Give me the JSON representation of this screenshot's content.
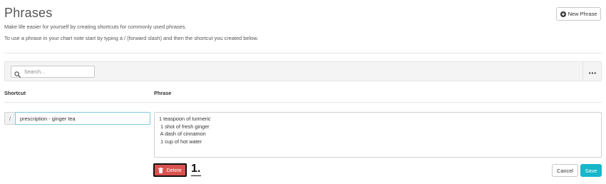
{
  "header": {
    "title": "Phrases",
    "intro_line_1": "Make life easier for yourself by creating shortcuts for commonly used phrases.",
    "intro_line_2": "To use a phrase in your chart note start by typing a / (forward slash) and then the shortcut you created below.",
    "new_phrase_label": "New Phrase",
    "new_phrase_icon": "plus-circle-icon"
  },
  "toolbar": {
    "search_placeholder": "Search...",
    "search_icon": "search-icon",
    "more_icon": "more-horizontal-icon"
  },
  "columns": {
    "shortcut": "Shortcut",
    "phrase": "Phrase"
  },
  "editor": {
    "slash_prefix": "/",
    "shortcut_value": "prescription - ginger tea",
    "phrase_value": "1 teaspoon of turmeric\n 1 shot of fresh ginger\n A dash of cinnamon\n 1 cup of hot water"
  },
  "actions": {
    "delete_label": "Delete",
    "delete_icon": "trash-icon",
    "delete_color": "#d9534f",
    "annotation_label": "1.",
    "cancel_label": "Cancel",
    "save_label": "Save",
    "save_color": "#18b7c9"
  }
}
